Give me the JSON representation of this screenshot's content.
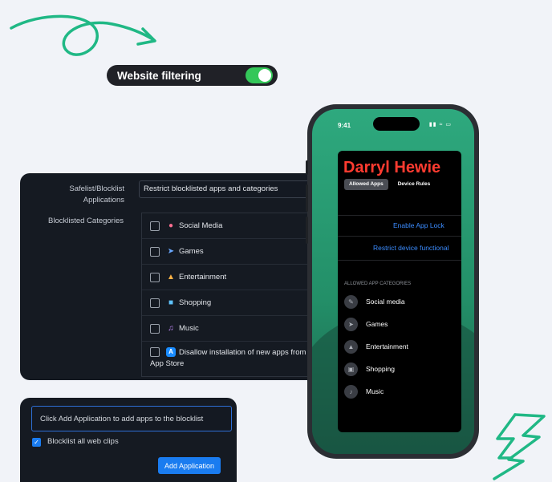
{
  "filter_pill": {
    "label": "Website filtering",
    "toggle_on": true,
    "toggle_color": "#34c759"
  },
  "settings_panel": {
    "safelist_label_line1": "Safelist/Blocklist",
    "safelist_label_line2": "Applications",
    "mode_value": "Restrict blocklisted apps and categories",
    "categories_label": "Blocklisted Categories",
    "categories": [
      {
        "icon": "social-media-icon",
        "label": "Social Media",
        "checked": false
      },
      {
        "icon": "rocket-icon",
        "label": "Games",
        "checked": false
      },
      {
        "icon": "popcorn-icon",
        "label": "Entertainment",
        "checked": false
      },
      {
        "icon": "shopping-icon",
        "label": "Shopping",
        "checked": false
      },
      {
        "icon": "music-icon",
        "label": "Music",
        "checked": false
      }
    ],
    "disallow_line1": "Disallow installation of new apps from",
    "disallow_line2": "App Store"
  },
  "blocklist_panel": {
    "input_placeholder": "Click Add Application to add apps to the blocklist",
    "checkbox_label": "Blocklist all web clips",
    "checkbox_checked": true,
    "button_label": "Add Application",
    "accent": "#1a7cf0"
  },
  "phone": {
    "time": "9:41",
    "app_title": "Darryl Hewie",
    "tabs": [
      {
        "label": "Allowed Apps",
        "active": true
      },
      {
        "label": "Device Rules",
        "active": false
      }
    ],
    "links": [
      "Enable App Lock",
      "Restrict device functional"
    ],
    "section_heading": "ALLOWED APP CATEGORIES",
    "allowed_categories": [
      {
        "icon": "chat-icon",
        "label": "Social media"
      },
      {
        "icon": "rocket-icon",
        "label": "Games"
      },
      {
        "icon": "popcorn-icon",
        "label": "Entertainment"
      },
      {
        "icon": "cart-icon",
        "label": "Shopping"
      },
      {
        "icon": "music-note-icon",
        "label": "Music"
      }
    ],
    "title_color": "#ff3b30",
    "link_color": "#3b8cff"
  }
}
